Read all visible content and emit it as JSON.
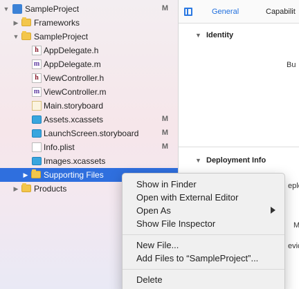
{
  "navigator": {
    "items": [
      {
        "label": "SampleProject",
        "badge": "M"
      },
      {
        "label": "Frameworks",
        "badge": ""
      },
      {
        "label": "SampleProject",
        "badge": ""
      },
      {
        "label": "AppDelegate.h",
        "badge": ""
      },
      {
        "label": "AppDelegate.m",
        "badge": ""
      },
      {
        "label": "ViewController.h",
        "badge": ""
      },
      {
        "label": "ViewController.m",
        "badge": ""
      },
      {
        "label": "Main.storyboard",
        "badge": ""
      },
      {
        "label": "Assets.xcassets",
        "badge": "M"
      },
      {
        "label": "LaunchScreen.storyboard",
        "badge": "M"
      },
      {
        "label": "Info.plist",
        "badge": "M"
      },
      {
        "label": "Images.xcassets",
        "badge": ""
      },
      {
        "label": "Supporting Files",
        "badge": ""
      },
      {
        "label": "Products",
        "badge": ""
      }
    ],
    "file_glyphs": {
      "h": "h",
      "m": "m"
    }
  },
  "editor": {
    "tabs": {
      "general": "General",
      "capabilities": "Capabilit"
    },
    "sections": {
      "identity": "Identity",
      "deployment": "Deployment Info"
    },
    "fragments": [
      "Bu",
      "eplo",
      "M",
      "evic"
    ]
  },
  "context_menu": {
    "items": [
      "Show in Finder",
      "Open with External Editor",
      "Open As",
      "Show File Inspector",
      "New File...",
      "Add Files to “SampleProject”...",
      "Delete"
    ]
  },
  "colors": {
    "selection": "#2f6fde",
    "accent": "#1f6fde"
  }
}
